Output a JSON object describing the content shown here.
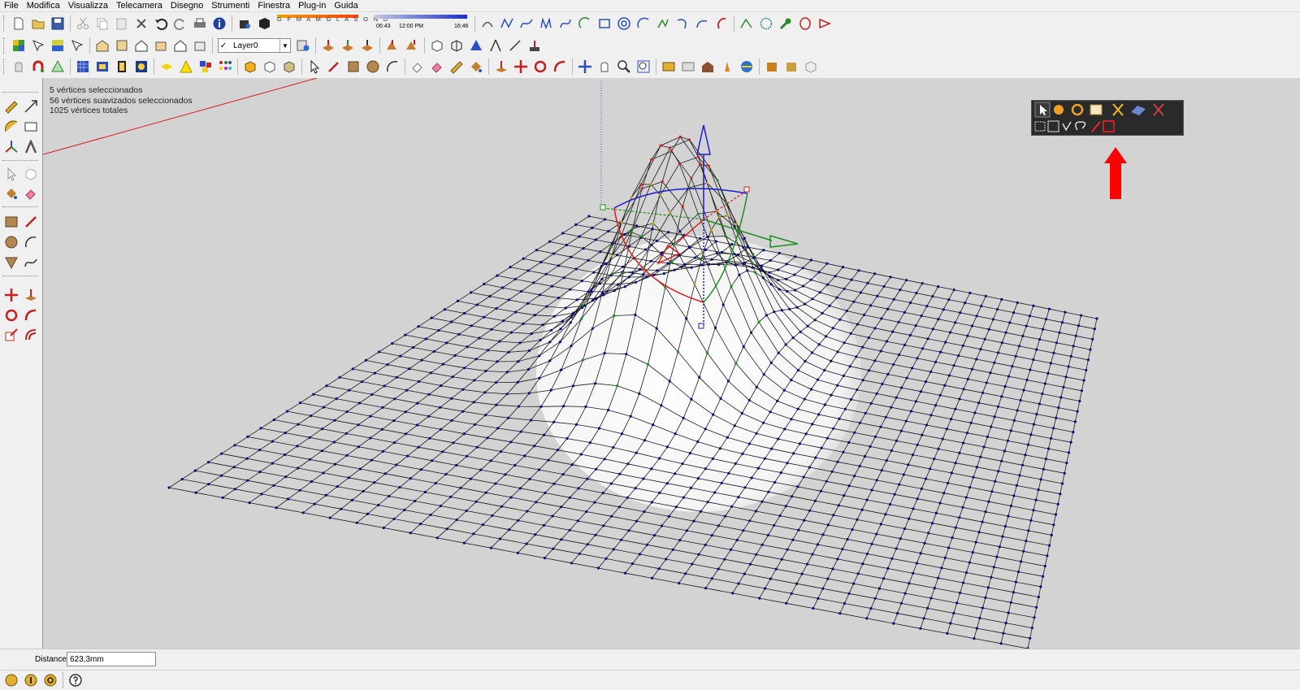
{
  "menu": [
    "File",
    "Modifica",
    "Visualizza",
    "Telecamera",
    "Disegno",
    "Strumenti",
    "Finestra",
    "Plug-in",
    "Guida"
  ],
  "shadow": {
    "months": "G F M A M G L A S O N D",
    "time_start": "06:43",
    "time_noon": "12:00 PM",
    "time_end": "16:46"
  },
  "layer": {
    "name": "Layer0"
  },
  "selection_info": [
    "5 vértices seleccionados",
    "56 vértices suavizados seleccionados",
    "1025 vértices totales"
  ],
  "measurements": {
    "label": "Distance",
    "value": "623,3mm"
  },
  "colors": {
    "viewport_bg": "#d3d3d3",
    "mesh_vertex": "#0c0c80",
    "axis_blue": "#1b1bd6",
    "axis_red": "#d81b1b",
    "axis_green": "#1b8f1b",
    "annotation_arrow": "#ff0000"
  }
}
